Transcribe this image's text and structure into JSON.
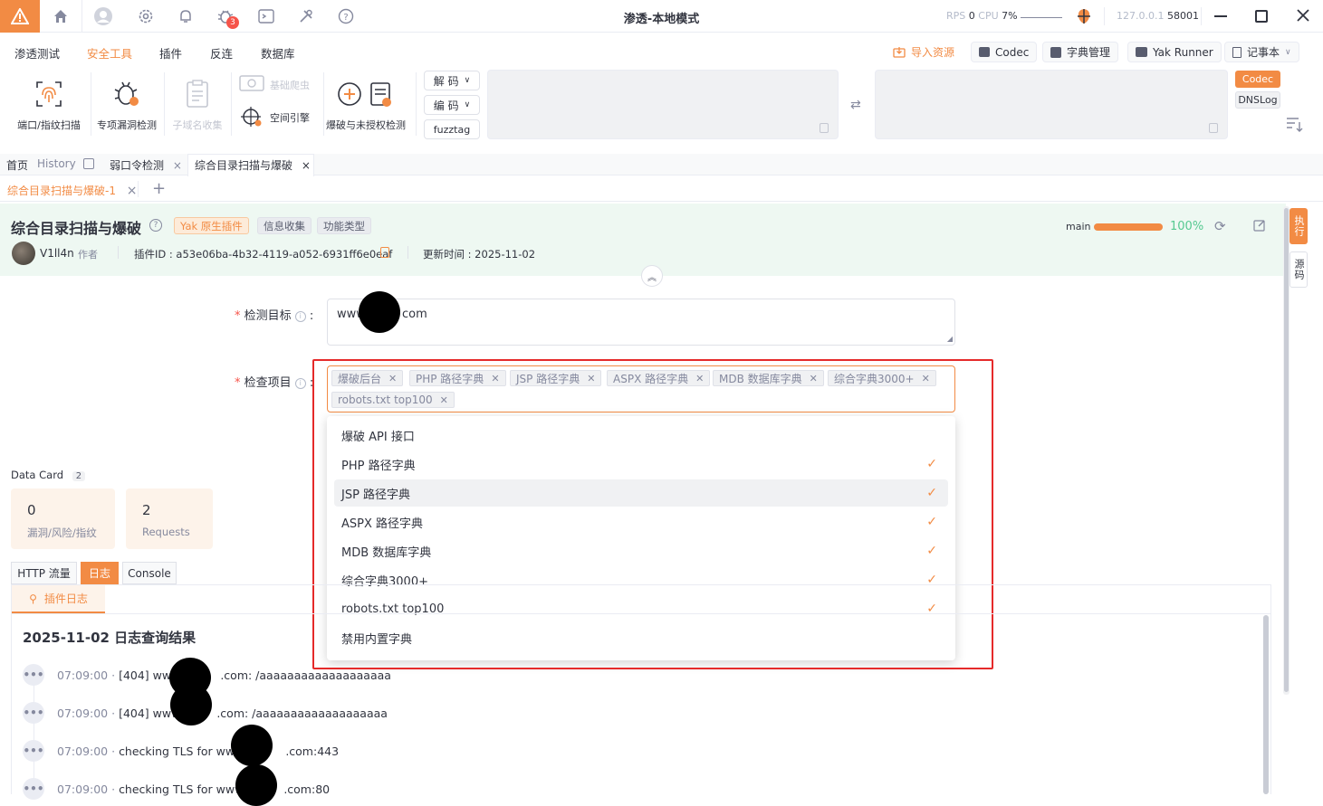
{
  "window": {
    "title": "渗透-本地模式",
    "rps_label": "RPS",
    "rps_value": "0",
    "cpu_label": "CPU",
    "cpu_value": "7%",
    "host": "127.0.0.1",
    "port": "58001"
  },
  "menu": [
    "渗透测试",
    "安全工具",
    "插件",
    "反连",
    "数据库"
  ],
  "right_buttons": {
    "import": "导入资源",
    "codec": "Codec",
    "dict": "字典管理",
    "yak_runner": "Yak Runner",
    "notebook": "记事本"
  },
  "tools": {
    "port_scan": "端口/指纹扫描",
    "vuln_check": "专项漏洞检测",
    "subdomain": "子域名收集",
    "crawler": "基础爬虫",
    "space_engine": "空间引擎",
    "brute": "爆破与未授权检测"
  },
  "codec_panel": {
    "decode": "解 码",
    "encode": "编 码",
    "fuzztag": "fuzztag",
    "codec_tab": "Codec",
    "dnslog_tab": "DNSLog"
  },
  "page_tabs": {
    "home": "首页",
    "history": "History",
    "weak_pwd": "弱口令检测",
    "active": "综合目录扫描与爆破"
  },
  "sub_tab": {
    "label": "综合目录扫描与爆破-1"
  },
  "plugin": {
    "title": "综合目录扫描与爆破",
    "tags": [
      "Yak 原生插件",
      "信息收集",
      "功能类型"
    ],
    "author": "V1ll4n",
    "author_role": "作者",
    "plugin_id": "插件ID : a53e06ba-4b32-4119-a052-6931ff6e0eaf",
    "updated": "更新时间 : 2025-11-02",
    "branch": "main",
    "progress_text": "100%",
    "progress_value": 1.0,
    "side_exec": "执行",
    "side_source": "源码"
  },
  "form": {
    "target_label": "检测目标",
    "target_value_prefix": "www",
    "target_value_suffix": "com",
    "items_label": "检查项目",
    "selected": [
      "爆破后台",
      "PHP 路径字典",
      "JSP 路径字典",
      "ASPX 路径字典",
      "MDB 数据库字典",
      "综合字典3000+",
      "robots.txt top100"
    ],
    "options": [
      {
        "label": "爆破 API 接口",
        "checked": false
      },
      {
        "label": "PHP 路径字典",
        "checked": true
      },
      {
        "label": "JSP 路径字典",
        "checked": true
      },
      {
        "label": "ASPX 路径字典",
        "checked": true
      },
      {
        "label": "MDB 数据库字典",
        "checked": true
      },
      {
        "label": "综合字典3000+",
        "checked": true
      },
      {
        "label": "robots.txt top100",
        "checked": true
      },
      {
        "label": "禁用内置字典",
        "checked": false
      }
    ]
  },
  "data_card": {
    "title": "Data Card",
    "count": "2",
    "vuln_value": "0",
    "vuln_label": "漏洞/风险/指纹",
    "req_value": "2",
    "req_label": "Requests"
  },
  "bottom_tabs": [
    "HTTP 流量",
    "日志",
    "Console"
  ],
  "log_tab": "插件日志",
  "log_title": "2025-11-02 日志查询结果",
  "logs": [
    {
      "time": "07:09:00",
      "text": "[404] www",
      "tail": ".com: /aaaaaaaaaaaaaaaaaaa"
    },
    {
      "time": "07:09:00",
      "text": "[404] www",
      "tail": ".com: /aaaaaaaaaaaaaaaaaaa"
    },
    {
      "time": "07:09:00",
      "text": "checking TLS for www",
      "tail": ".com:443"
    },
    {
      "time": "07:09:00",
      "text": "checking TLS for www",
      "tail": ".com:80"
    }
  ]
}
